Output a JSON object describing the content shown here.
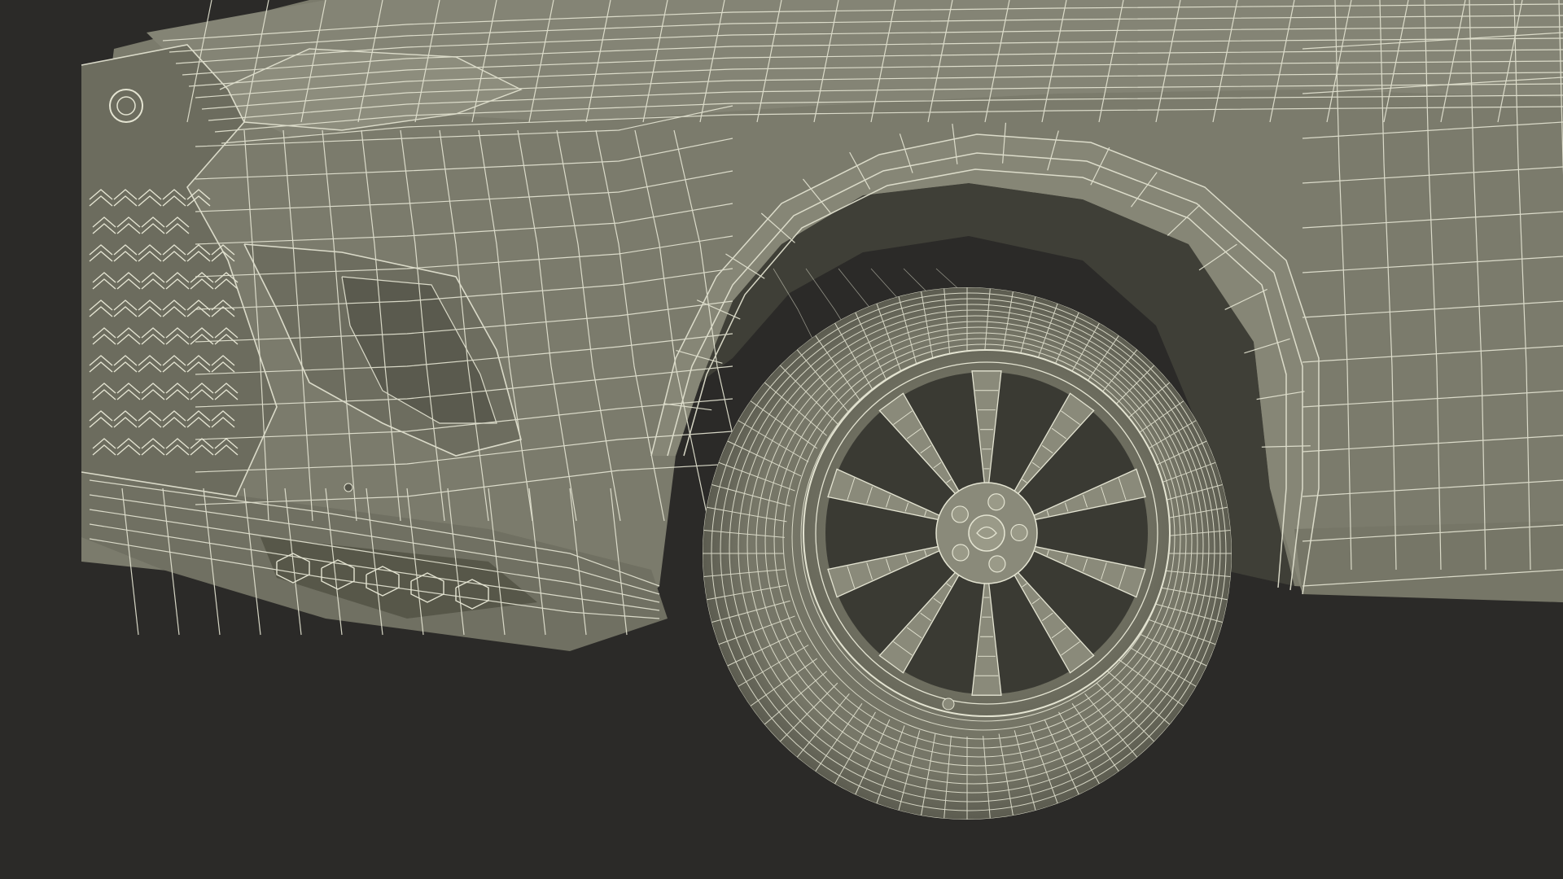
{
  "scene": {
    "subject": "wireframe-render",
    "colors": {
      "background": "#2b2a28",
      "surface": "#7a7a6b",
      "surface_light": "#8a8a7a",
      "surface_dark": "#55554a",
      "shadow": "#3e3e36",
      "wire": "#e4e4d2"
    }
  }
}
